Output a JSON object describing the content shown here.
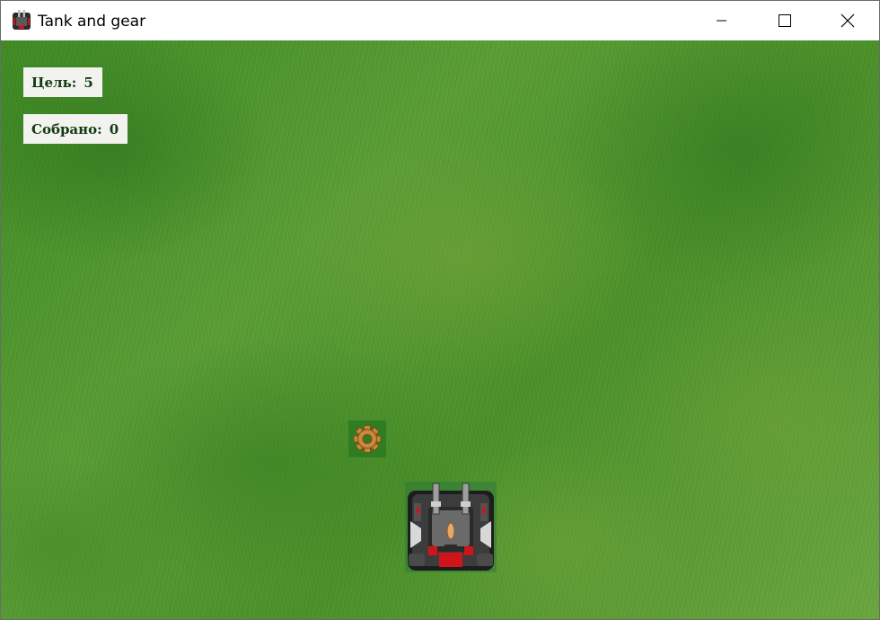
{
  "window": {
    "title": "Tank and gear",
    "controls": {
      "minimize": "minimize-icon",
      "maximize": "maximize-icon",
      "close": "close-icon"
    }
  },
  "hud": {
    "target_label": "Цель:",
    "target_value": "5",
    "collected_label": "Собрано:",
    "collected_value": "0"
  },
  "sprites": {
    "gear": "gear-icon",
    "tank": "tank-sprite"
  },
  "colors": {
    "grass": "#4a8f2c",
    "hud_background": "#f2f2ee",
    "hud_text": "#0f3b12",
    "gear": "#c8893a",
    "tank_body": "#3a3a3a",
    "tank_accent": "#d0141a"
  }
}
